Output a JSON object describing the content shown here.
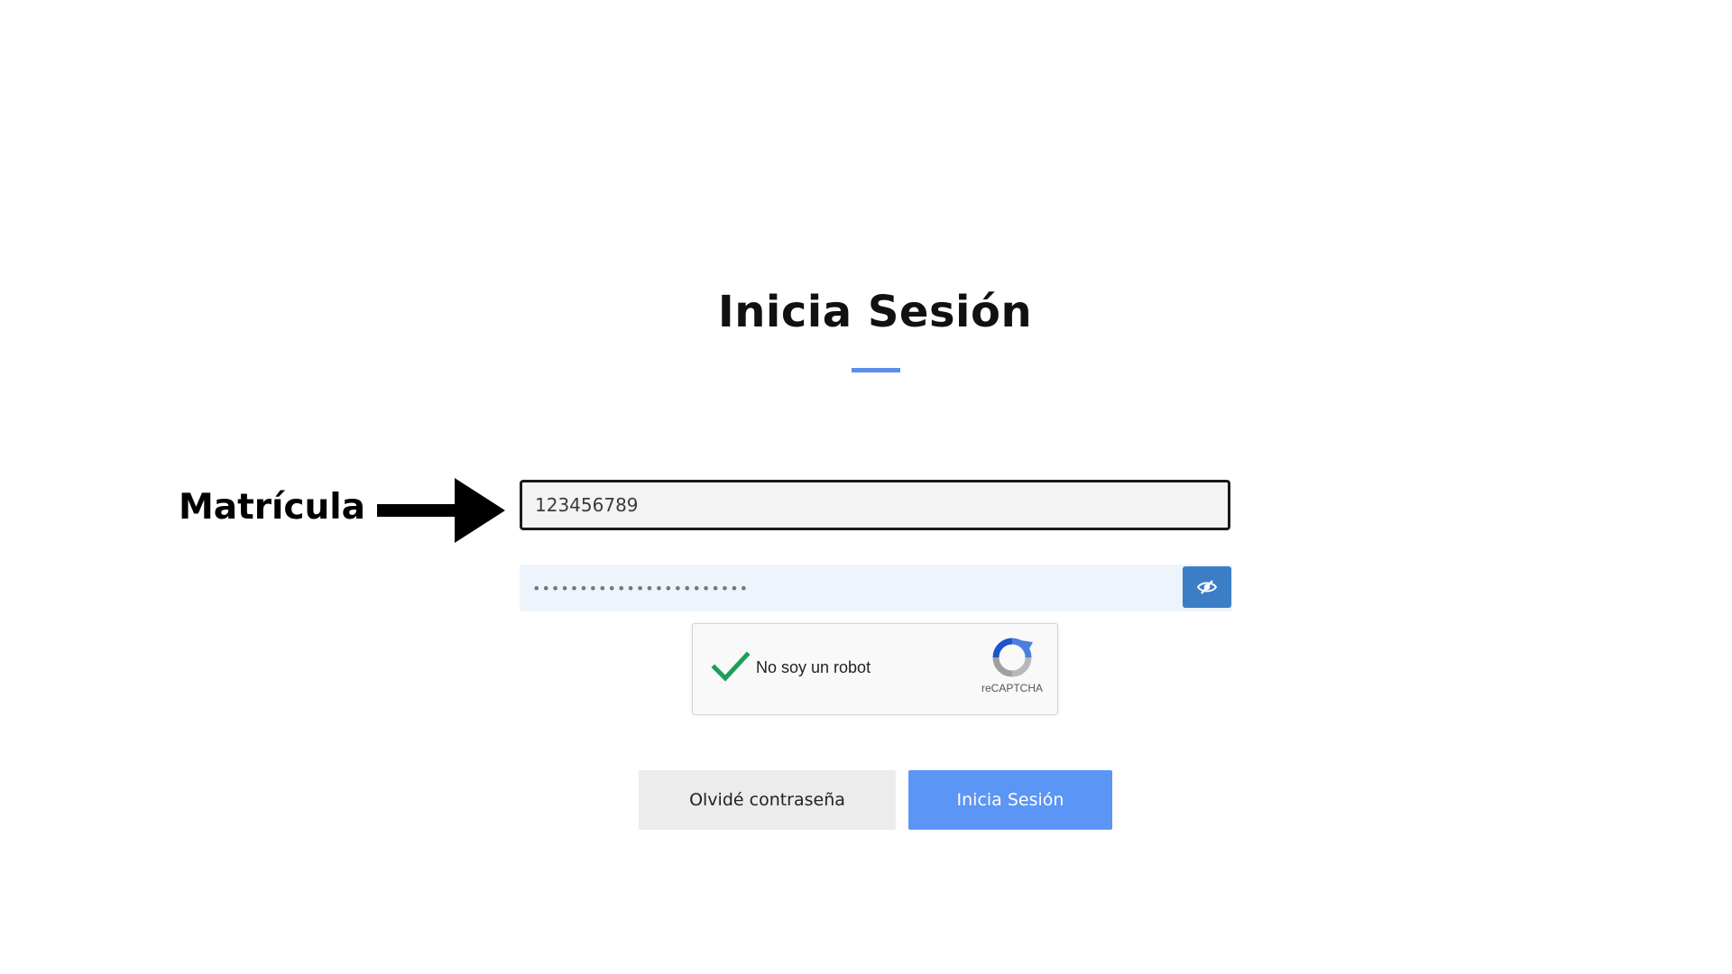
{
  "login": {
    "title": "Inicia Sesión",
    "matricula_value": "123456789",
    "password_value": "•••••••••••••••••••••••",
    "show_password_icon": "eye-slash-icon",
    "accent_color": "#5b8def"
  },
  "annotation": {
    "label": "Matrícula",
    "arrow_icon": "right-arrow-icon"
  },
  "captcha": {
    "label": "No soy un robot",
    "brand": "reCAPTCHA",
    "checked": true,
    "check_color": "#1e9e57"
  },
  "actions": {
    "forgot_label": "Olvidé contraseña",
    "login_label": "Inicia Sesión",
    "login_color": "#5b95f5"
  }
}
